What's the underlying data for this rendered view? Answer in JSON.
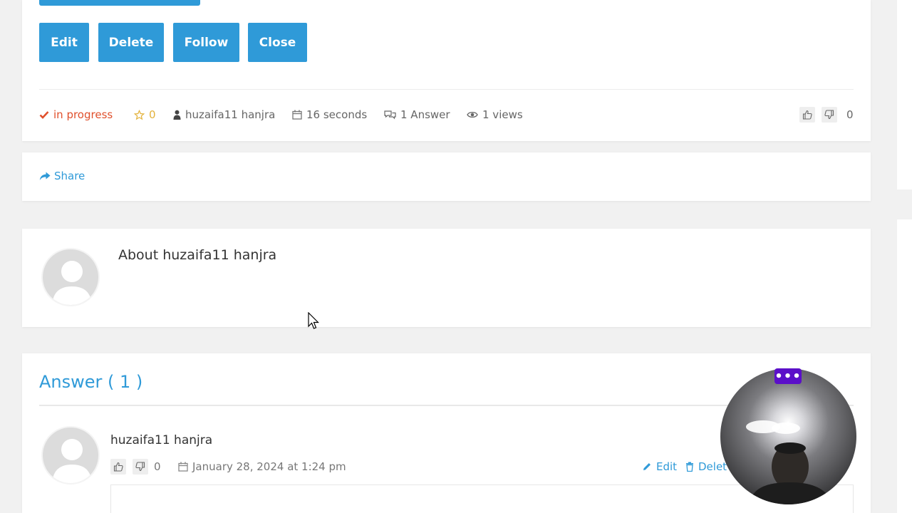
{
  "question": {
    "buttons": [
      "Edit",
      "Delete",
      "Follow",
      "Close"
    ],
    "status": "in progress",
    "stars": "0",
    "author": "huzaifa11 hanjra",
    "time": "16 seconds",
    "answers": "1 Answer",
    "views": "1 views",
    "votes": "0"
  },
  "share": {
    "label": "Share"
  },
  "about": {
    "title": "About huzaifa11 hanjra"
  },
  "answers_section": {
    "title": "Answer ( 1 )",
    "items": [
      {
        "author": "huzaifa11 hanjra",
        "votes": "0",
        "date": "January 28, 2024 at 1:24 pm",
        "edit_label": "Edit",
        "delete_label": "Delet"
      }
    ]
  },
  "webcam": {
    "menu_label": "•••"
  },
  "colors": {
    "primary": "#2f9ad8",
    "status": "#e0502c",
    "star": "#e3b23c",
    "webcam_menu": "#5b0fc9"
  }
}
